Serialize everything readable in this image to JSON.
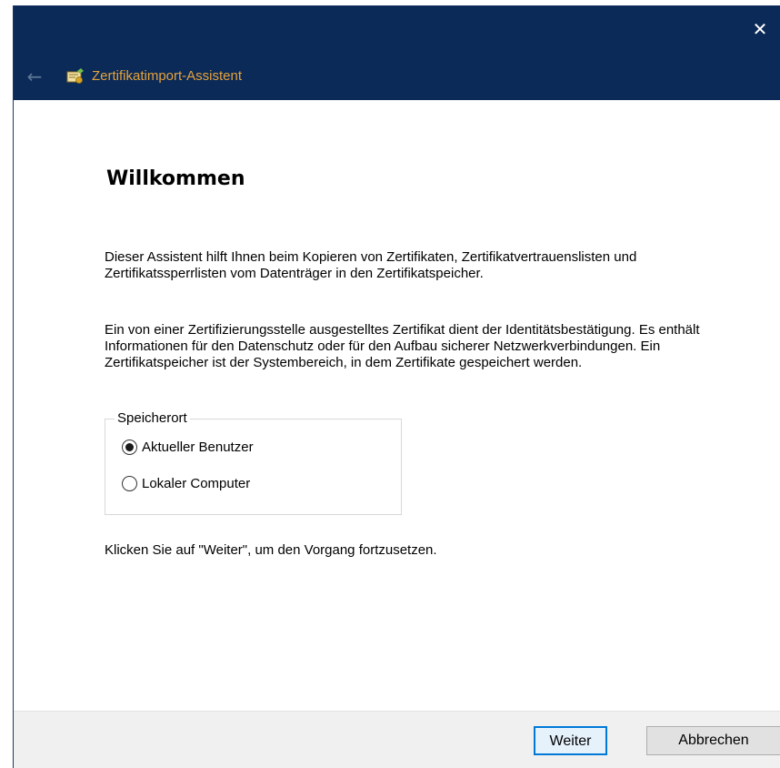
{
  "window": {
    "close_glyph": "✕"
  },
  "nav": {
    "back_glyph": "←",
    "wizard_icon": "certificate-icon",
    "title": "Zertifikatimport-Assistent",
    "title_color": "#e6a23c",
    "bar_color": "#0b2a57"
  },
  "content": {
    "heading": "Willkommen",
    "paragraph1": "Dieser Assistent hilft Ihnen beim Kopieren von Zertifikaten, Zertifikatvertrauenslisten und Zertifikatssperrlisten vom Datenträger in den Zertifikatspeicher.",
    "paragraph2": "Ein von einer Zertifizierungsstelle ausgestelltes Zertifikat dient der Identitätsbestätigung. Es enthält Informationen für den Datenschutz oder für den Aufbau sicherer Netzwerkverbindungen. Ein Zertifikatspeicher ist der Systembereich, in dem Zertifikate gespeichert werden.",
    "storage": {
      "legend": "Speicherort",
      "options": [
        {
          "label": "Aktueller Benutzer",
          "selected": true
        },
        {
          "label": "Lokaler Computer",
          "selected": false
        }
      ]
    },
    "paragraph3": "Klicken Sie auf \"Weiter\", um den Vorgang fortzusetzen."
  },
  "footer": {
    "next_label": "Weiter",
    "cancel_label": "Abbrechen",
    "accent_color": "#0078d7"
  }
}
